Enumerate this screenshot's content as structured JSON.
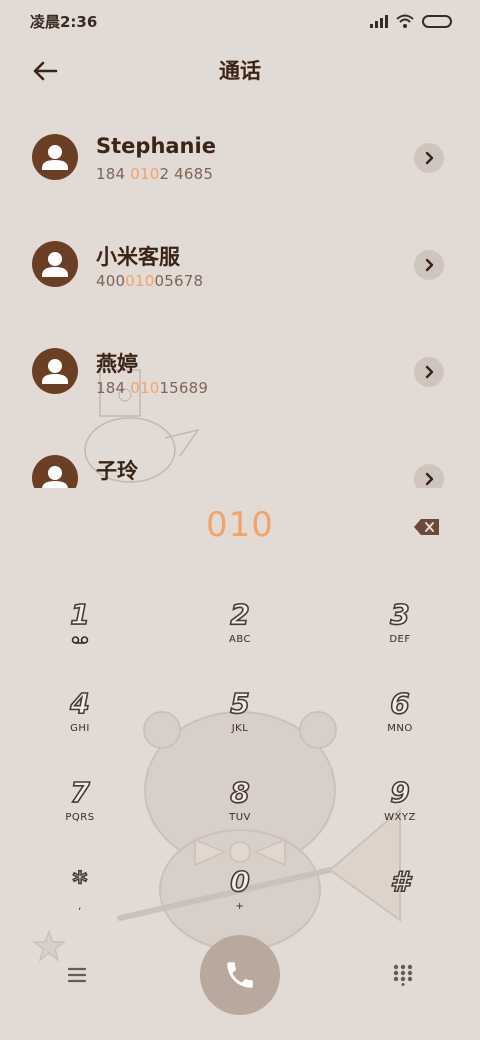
{
  "status_bar": {
    "time": "凌晨2:36"
  },
  "header": {
    "title": "通话"
  },
  "contacts": [
    {
      "name": "Stephanie",
      "number_before": "184 ",
      "number_match": "010",
      "number_after": "2 4685"
    },
    {
      "name": "小米客服",
      "number_before": "400",
      "number_match": "010",
      "number_after": "05678"
    },
    {
      "name": "燕婷",
      "number_before": "184 ",
      "number_match": "010",
      "number_after": "15689"
    },
    {
      "name": "子玲",
      "number_before": "",
      "number_match": "",
      "number_after": ""
    }
  ],
  "dialer": {
    "dialed_number": "010"
  },
  "keypad": [
    {
      "digit": "1",
      "letters": ""
    },
    {
      "digit": "2",
      "letters": "ABC"
    },
    {
      "digit": "3",
      "letters": "DEF"
    },
    {
      "digit": "4",
      "letters": "GHI"
    },
    {
      "digit": "5",
      "letters": "JKL"
    },
    {
      "digit": "6",
      "letters": "MNO"
    },
    {
      "digit": "7",
      "letters": "PQRS"
    },
    {
      "digit": "8",
      "letters": "TUV"
    },
    {
      "digit": "9",
      "letters": "WXYZ"
    },
    {
      "digit": "*",
      "letters": ","
    },
    {
      "digit": "0",
      "letters": "+"
    },
    {
      "digit": "#",
      "letters": ""
    }
  ],
  "colors": {
    "background": "#e2dbd5",
    "accent_orange": "#f2a468",
    "avatar_brown": "#6b3f24",
    "call_button": "#b8a89e"
  },
  "icons": {
    "back": "arrow-left-icon",
    "chevron": "chevron-right-icon",
    "delete": "backspace-icon",
    "voicemail": "voicemail-icon",
    "menu": "hamburger-menu-icon",
    "call": "phone-icon",
    "dialpad": "dialpad-grid-icon"
  }
}
